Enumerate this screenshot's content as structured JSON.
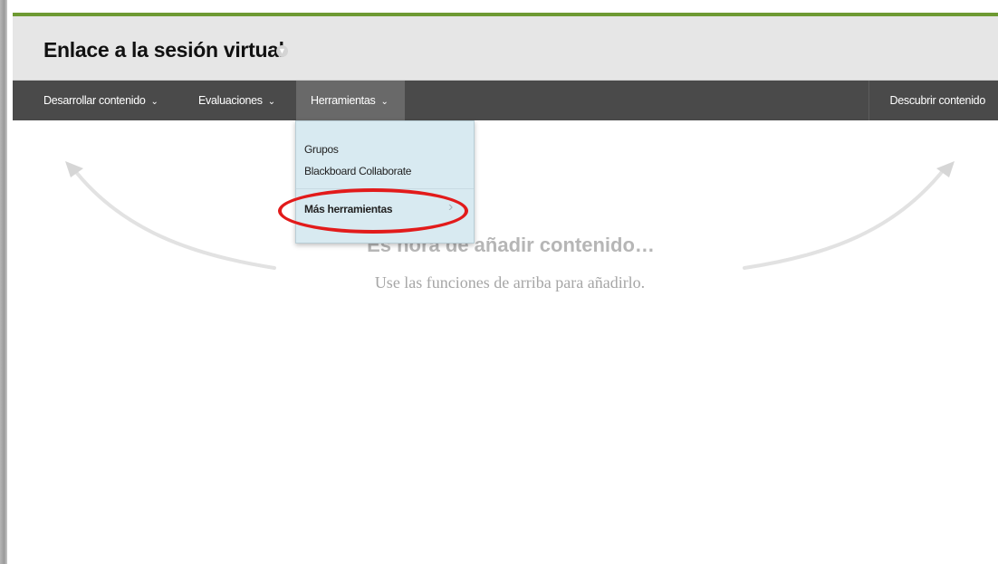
{
  "page": {
    "title": "Enlace a la sesión virtual",
    "title_chevron_icon": "chevron-down-icon"
  },
  "nav": {
    "items": [
      {
        "label": "Desarrollar contenido",
        "icon": "chevron-down-icon"
      },
      {
        "label": "Evaluaciones",
        "icon": "chevron-down-icon"
      },
      {
        "label": "Herramientas",
        "icon": "chevron-down-icon",
        "active": true
      }
    ],
    "discover_label": "Descubrir contenido"
  },
  "dropdown": {
    "items": [
      {
        "label": "Grupos"
      },
      {
        "label": "Blackboard Collaborate"
      },
      {
        "label": "Más herramientas",
        "icon": "chevron-right-icon",
        "highlighted": true
      }
    ]
  },
  "empty_state": {
    "heading": "Es hora de añadir contenido…",
    "subtext": "Use las funciones de arriba para añadirlo."
  },
  "colors": {
    "accent_green": "#6e9a32",
    "nav_bg": "#4a4a4a",
    "dropdown_bg": "#d8eaf1",
    "highlight_red": "#e21b1b"
  }
}
